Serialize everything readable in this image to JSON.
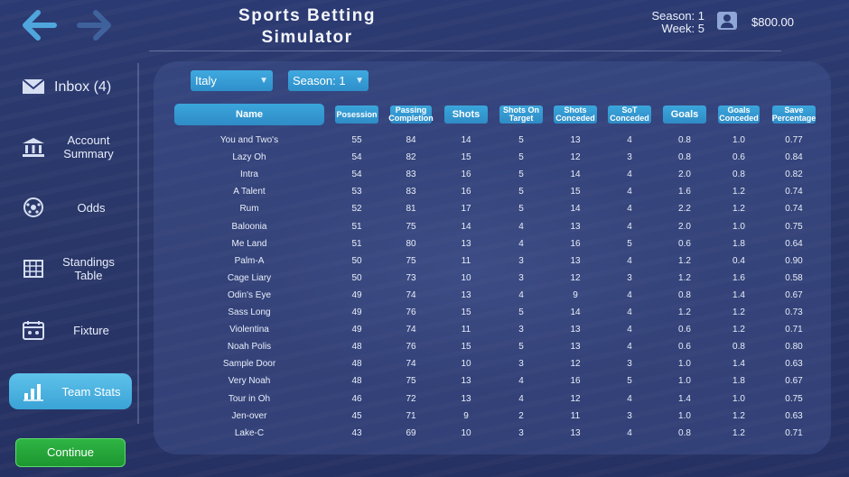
{
  "header": {
    "title_line1": "Sports Betting",
    "title_line2": "Simulator",
    "season_text": "Season: 1",
    "week_text": "Week: 5",
    "balance": "$800.00",
    "back_icon": "arrow-left-icon",
    "forward_icon": "arrow-right-icon",
    "user_icon": "user-profile-icon"
  },
  "sidebar": {
    "items": [
      {
        "label": "Inbox (4)",
        "icon": "envelope-icon"
      },
      {
        "label": "Account Summary",
        "icon": "bank-icon"
      },
      {
        "label": "Odds",
        "icon": "ball-icon"
      },
      {
        "label": "Standings Table",
        "icon": "table-grid-icon"
      },
      {
        "label": "Fixture",
        "icon": "calendar-icon"
      },
      {
        "label": "Team Stats",
        "icon": "bar-chart-icon",
        "active": true
      }
    ],
    "continue_label": "Continue"
  },
  "filters": {
    "league": "Italy",
    "season": "Season: 1"
  },
  "colors": {
    "accent": "#3aa6dc",
    "continue": "#2fb544",
    "background": "#2b3a72"
  },
  "table": {
    "headers": [
      "Name",
      "Posession",
      "Passing Completion",
      "Shots",
      "Shots On Target",
      "Shots Conceded",
      "SoT Conceded",
      "Goals",
      "Goals Conceded",
      "Save Percentage"
    ],
    "rows": [
      [
        "You and Two's",
        "55",
        "84",
        "14",
        "5",
        "13",
        "4",
        "0.8",
        "1.0",
        "0.77"
      ],
      [
        "Lazy Oh",
        "54",
        "82",
        "15",
        "5",
        "12",
        "3",
        "0.8",
        "0.6",
        "0.84"
      ],
      [
        "Intra",
        "54",
        "83",
        "16",
        "5",
        "14",
        "4",
        "2.0",
        "0.8",
        "0.82"
      ],
      [
        "A Talent",
        "53",
        "83",
        "16",
        "5",
        "15",
        "4",
        "1.6",
        "1.2",
        "0.74"
      ],
      [
        "Rum",
        "52",
        "81",
        "17",
        "5",
        "14",
        "4",
        "2.2",
        "1.2",
        "0.74"
      ],
      [
        "Baloonia",
        "51",
        "75",
        "14",
        "4",
        "13",
        "4",
        "2.0",
        "1.0",
        "0.75"
      ],
      [
        "Me Land",
        "51",
        "80",
        "13",
        "4",
        "16",
        "5",
        "0.6",
        "1.8",
        "0.64"
      ],
      [
        "Palm-A",
        "50",
        "75",
        "11",
        "3",
        "13",
        "4",
        "1.2",
        "0.4",
        "0.90"
      ],
      [
        "Cage Liary",
        "50",
        "73",
        "10",
        "3",
        "12",
        "3",
        "1.2",
        "1.6",
        "0.58"
      ],
      [
        "Odin's Eye",
        "49",
        "74",
        "13",
        "4",
        "9",
        "4",
        "0.8",
        "1.4",
        "0.67"
      ],
      [
        "Sass Long",
        "49",
        "76",
        "15",
        "5",
        "14",
        "4",
        "1.2",
        "1.2",
        "0.73"
      ],
      [
        "Violentina",
        "49",
        "74",
        "11",
        "3",
        "13",
        "4",
        "0.6",
        "1.2",
        "0.71"
      ],
      [
        "Noah Polis",
        "48",
        "76",
        "15",
        "5",
        "13",
        "4",
        "0.6",
        "0.8",
        "0.80"
      ],
      [
        "Sample Door",
        "48",
        "74",
        "10",
        "3",
        "12",
        "3",
        "1.0",
        "1.4",
        "0.63"
      ],
      [
        "Very Noah",
        "48",
        "75",
        "13",
        "4",
        "16",
        "5",
        "1.0",
        "1.8",
        "0.67"
      ],
      [
        "Tour in Oh",
        "46",
        "72",
        "13",
        "4",
        "12",
        "4",
        "1.4",
        "1.0",
        "0.75"
      ],
      [
        "Jen-over",
        "45",
        "71",
        "9",
        "2",
        "11",
        "3",
        "1.0",
        "1.2",
        "0.63"
      ],
      [
        "Lake-C",
        "43",
        "69",
        "10",
        "3",
        "13",
        "4",
        "0.8",
        "1.2",
        "0.71"
      ]
    ]
  }
}
